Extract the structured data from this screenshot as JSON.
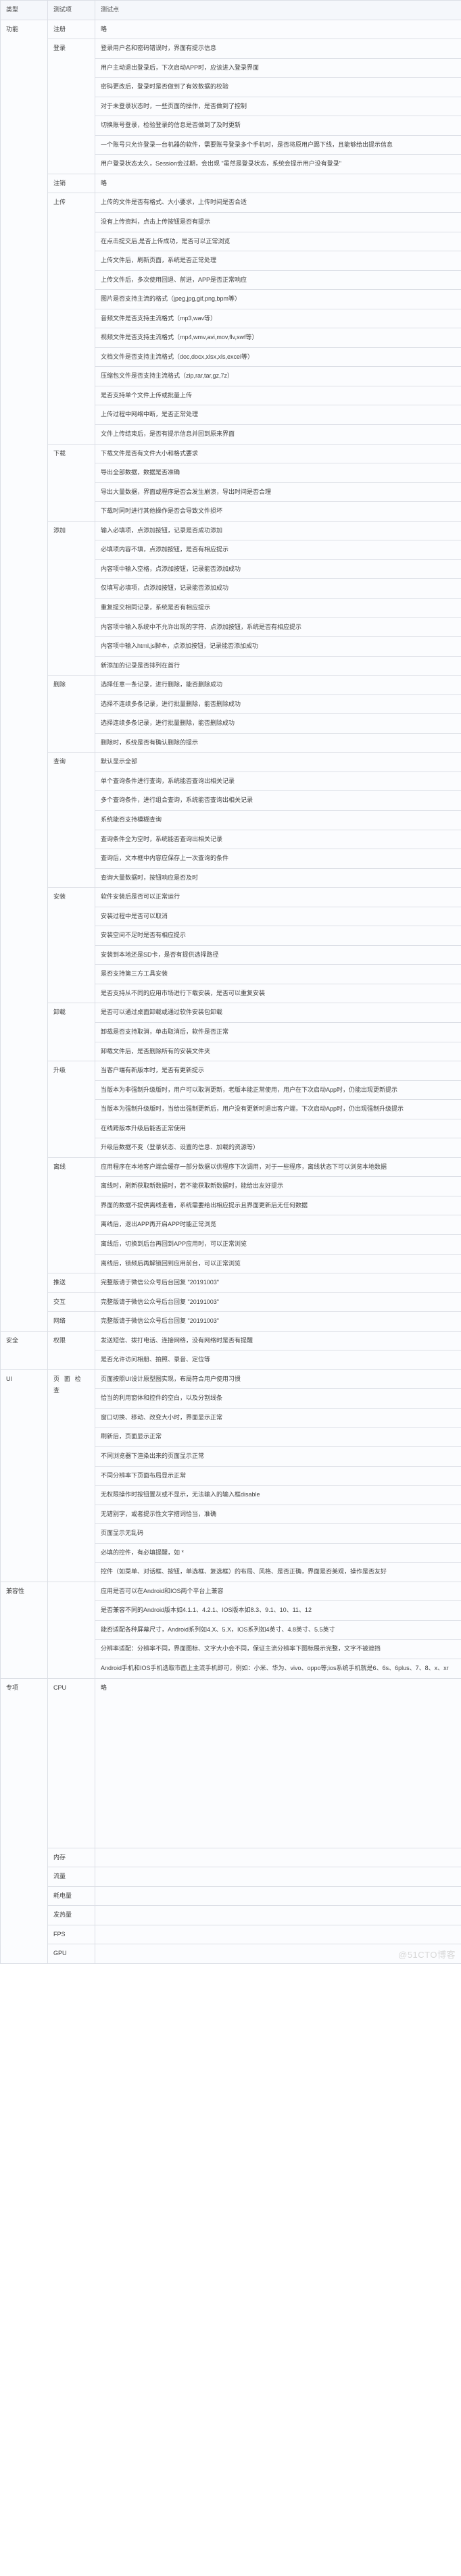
{
  "table": {
    "headers": {
      "type": "类型",
      "item": "测试项",
      "point": "测试点"
    },
    "watermark": "@51CTO博客",
    "placeholder_text": "完整版请于微信公众号后台回复 \"20191003\"",
    "omitted": "略",
    "categories": [
      {
        "name": "功能",
        "groups": [
          {
            "name": "注册",
            "points": [
              "略"
            ]
          },
          {
            "name": "登录",
            "points": [
              "登录用户名和密码错误时，界面有提示信息",
              "用户主动退出登录后，下次启动APP时，应该进入登录界面",
              "密码更改后，登录时是否做到了有效数据的校验",
              "对于未登录状态时，一些页面的操作，是否做到了控制",
              "切换账号登录，检验登录的信息是否做到了及时更新",
              "一个账号只允许登录一台机器的软件，需要账号登录多个手机时，是否将原用户踢下线，且能够给出提示信息",
              "用户登录状态太久，Session会过期，会出现 \"虽然是登录状态，系统会提示用户没有登录\""
            ]
          },
          {
            "name": "注销",
            "points": [
              "略"
            ]
          },
          {
            "name": "上传",
            "points": [
              "上传的文件是否有格式、大小要求，上传时间是否合适",
              "没有上传资料，点击上传按钮是否有提示",
              "在点击提交后,是否上传成功，是否可以正常浏览",
              "上传文件后，刷新页面，系统是否正常处理",
              "上传文件后，多次使用回退、前进，APP是否正常响应",
              "图片是否支持主流的格式（jpeg,jpg,gif,png,bpm等）",
              "音频文件是否支持主流格式（mp3,wav等）",
              "视频文件是否支持主流格式（mp4,wmv,avi,mov,flv,swf等）",
              "文档文件是否支持主流格式（doc,docx,xlsx,xls,excel等）",
              "压缩包文件是否支持主流格式（zip,rar,tar,gz,7z）",
              "是否支持单个文件上传或批量上传",
              "上传过程中网络中断，是否正常处理",
              "文件上传结束后，是否有提示信息并回到原来界面"
            ]
          },
          {
            "name": "下载",
            "points": [
              "下载文件是否有文件大小和格式要求",
              "导出全部数据，数据是否准确",
              "导出大量数据，界面或程序是否会发生崩溃，导出时间是否合理",
              "下载时同时进行其他操作是否会导致文件损坏"
            ]
          },
          {
            "name": "添加",
            "points": [
              "输入必填项，点添加按钮，记录是否成功添加",
              "必填项内容不填，点添加按钮，是否有相应提示",
              "内容项中输入空格，点添加按钮，记录能否添加成功",
              "仅填写必填项，点添加按钮，记录能否添加成功",
              "重复提交相同记录，系统是否有相应提示",
              "内容项中输入系统中不允许出现的字符、点添加按钮，系统是否有相应提示",
              "内容项中输入html,js脚本，点添加按钮，记录能否添加成功",
              "新添加的记录是否排列在首行"
            ]
          },
          {
            "name": "删除",
            "points": [
              "选择任意一条记录，进行删除，能否删除成功",
              "选择不连续多条记录，进行批量删除，能否删除成功",
              "选择连续多条记录，进行批量删除，能否删除成功",
              "删除时，系统是否有确认删除的提示"
            ]
          },
          {
            "name": "查询",
            "points": [
              "默认显示全部",
              "单个查询条件进行查询，系统能否查询出相关记录",
              "多个查询条件，进行组合查询，系统能否查询出相关记录",
              "系统能否支持模糊查询",
              "查询条件全为空时，系统能否查询出相关记录",
              "查询后，文本框中内容应保存上一次查询的条件",
              "查询大量数据时，按钮响应是否及时"
            ]
          },
          {
            "name": "安装",
            "points": [
              "软件安装后是否可以正常运行",
              "安装过程中是否可以取消",
              "安装空间不足时是否有相应提示",
              "安装到本地还是SD卡，是否有提供选择路径",
              "是否支持第三方工具安装",
              "是否支持从不同的应用市场进行下载安装，是否可以重复安装"
            ]
          },
          {
            "name": "卸载",
            "points": [
              "是否可以通过桌面卸载或通过软件安装包卸载",
              "卸载是否支持取消，单击取消后，软件是否正常",
              "卸载文件后，是否删除所有的安装文件夹"
            ]
          },
          {
            "name": "升级",
            "points": [
              "当客户端有新版本时，是否有更新提示",
              "当版本为非强制升级版时，用户可以取消更新，老版本能正常使用，用户在下次启动App时，仍能出现更新提示",
              "当版本为强制升级版时，当给出强制更新后，用户没有更新时退出客户端，下次启动App时，仍出现强制升级提示",
              "在线跨版本升级后能否正常使用",
              "升级后数据不变（登录状态、设置的信息、加载的资源等）"
            ]
          },
          {
            "name": "离线",
            "points": [
              "应用程序在本地客户端会缓存一部分数据以供程序下次调用，对于一些程序，离线状态下可以浏览本地数据",
              "离线时，刷新获取新数据时，若不能获取新数据时，能给出友好提示",
              "界面的数据不提供离线查看，系统需要给出相应提示且界面更新后无任何数据",
              "离线后，退出APP再开启APP时能正常浏览",
              "离线后，切换到后台再回到APP应用时，可以正常浏览",
              "离线后，锁频后再解锁回到应用前台，可以正常浏览"
            ]
          },
          {
            "name": "推送",
            "points": [
              "完整版请于微信公众号后台回复 \"20191003\""
            ]
          },
          {
            "name": "交互",
            "points": [
              "完整版请于微信公众号后台回复 \"20191003\""
            ]
          },
          {
            "name": "网络",
            "points": [
              "完整版请于微信公众号后台回复 \"20191003\""
            ]
          }
        ]
      },
      {
        "name": "安全",
        "groups": [
          {
            "name": "权限",
            "points": [
              "发送短信、拨打电话、连接网络，没有网络时是否有提醒",
              "是否允许访问相册、拍照、录音、定位等"
            ]
          }
        ]
      },
      {
        "name": "UI",
        "groups": [
          {
            "name": "页 面 检 查",
            "points": [
              "页面按照UI设计原型图实现，布局符合用户使用习惯",
              "恰当的利用窗体和控件的空白，以及分割线条",
              "窗口切换、移动、改变大小时，界面显示正常",
              "刷新后，页面显示正常",
              "不同浏览器下渲染出来的页面显示正常",
              "不同分辨率下页面布局显示正常",
              "无权限操作时按钮置灰或不显示，无法输入的输入框disable",
              "无错别字，或者提示性文字措词恰当，准确",
              "页面显示无乱码",
              "必填的控件，有必填提醒，如 *",
              "控件（如菜单、对话框、按钮，单选框、复选框）的布局、风格、是否正确，界面是否美观，操作是否友好"
            ]
          }
        ]
      },
      {
        "name": "兼容性",
        "groups": [
          {
            "name": "",
            "points": [
              "应用是否可以在Android和IOS两个平台上兼容",
              "是否兼容不同的Android版本如4.1.1、4.2.1、IOS版本如8.3、9.1、10、11、12",
              "能否适配各种屏幕尺寸，Android系列如4.X、5.X，IOS系列如4英寸、4.8英寸、5.5英寸",
              "分辨率适配：分辨率不同，界面图标、文字大小会不同，保证主流分辨率下图标展示完整，文字不被遮挡",
              "Android手机和IOS手机选取市面上主流手机即可，例如：小米、华为、vivo、oppo等;ios系统手机就是6、6s、6plus、7、8、x、xr"
            ]
          }
        ]
      },
      {
        "name": "专项",
        "groups": [
          {
            "name": "CPU",
            "points": [
              "略"
            ]
          },
          {
            "name": "内存",
            "points": [
              ""
            ]
          },
          {
            "name": "流量",
            "points": [
              ""
            ]
          },
          {
            "name": "耗电量",
            "points": [
              ""
            ]
          },
          {
            "name": "发热量",
            "points": [
              ""
            ]
          },
          {
            "name": "FPS",
            "points": [
              ""
            ]
          },
          {
            "name": "GPU",
            "points": [
              ""
            ]
          }
        ]
      }
    ]
  }
}
